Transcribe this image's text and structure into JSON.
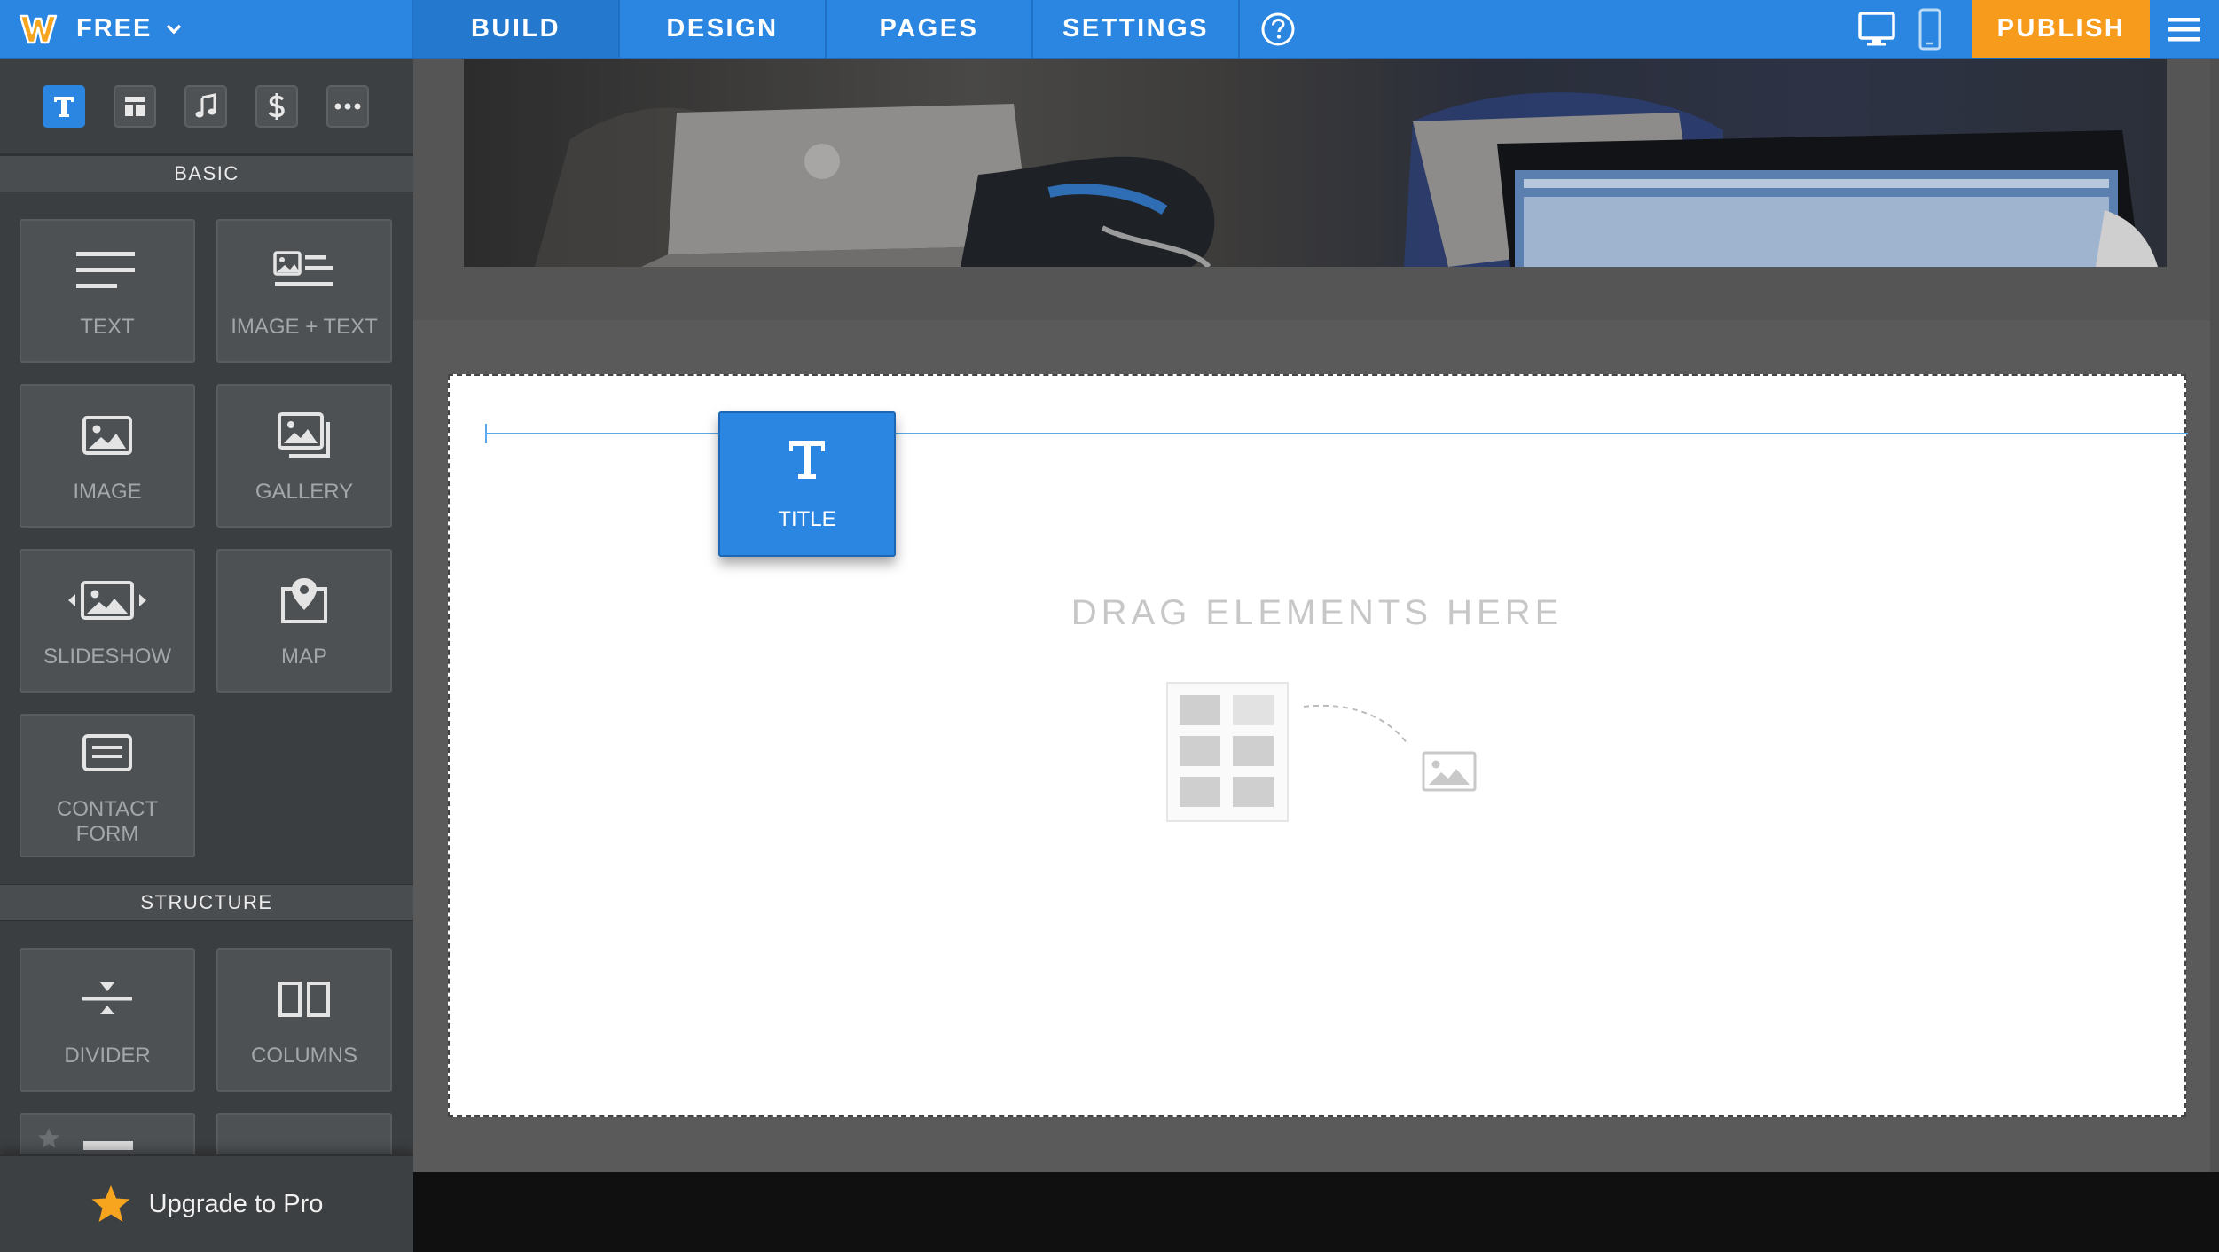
{
  "topbar": {
    "plan": "FREE",
    "tabs": [
      {
        "label": "BUILD",
        "active": true
      },
      {
        "label": "DESIGN",
        "active": false
      },
      {
        "label": "PAGES",
        "active": false
      },
      {
        "label": "SETTINGS",
        "active": false
      }
    ],
    "publish": "PUBLISH"
  },
  "sidebar": {
    "categories": [
      "text-icon",
      "layout-icon",
      "music-icon",
      "dollar-icon",
      "more-icon"
    ],
    "basic_header": "BASIC",
    "basic_items": [
      {
        "label": "TEXT",
        "icon": "text-lines-icon"
      },
      {
        "label": "IMAGE + TEXT",
        "icon": "image-text-icon"
      },
      {
        "label": "IMAGE",
        "icon": "image-icon"
      },
      {
        "label": "GALLERY",
        "icon": "gallery-icon"
      },
      {
        "label": "SLIDESHOW",
        "icon": "slideshow-icon"
      },
      {
        "label": "MAP",
        "icon": "map-pin-icon"
      },
      {
        "label": "CONTACT FORM",
        "icon": "contact-form-icon"
      }
    ],
    "structure_header": "STRUCTURE",
    "structure_items": [
      {
        "label": "DIVIDER",
        "icon": "divider-icon"
      },
      {
        "label": "COLUMNS",
        "icon": "columns-icon"
      }
    ],
    "upgrade": "Upgrade to Pro"
  },
  "canvas": {
    "drop_hint": "DRAG ELEMENTS HERE",
    "dragging_element": "TITLE"
  },
  "colors": {
    "accent": "#2a86e0",
    "publish": "#f79b1c",
    "sidebar": "#3b3e40"
  }
}
